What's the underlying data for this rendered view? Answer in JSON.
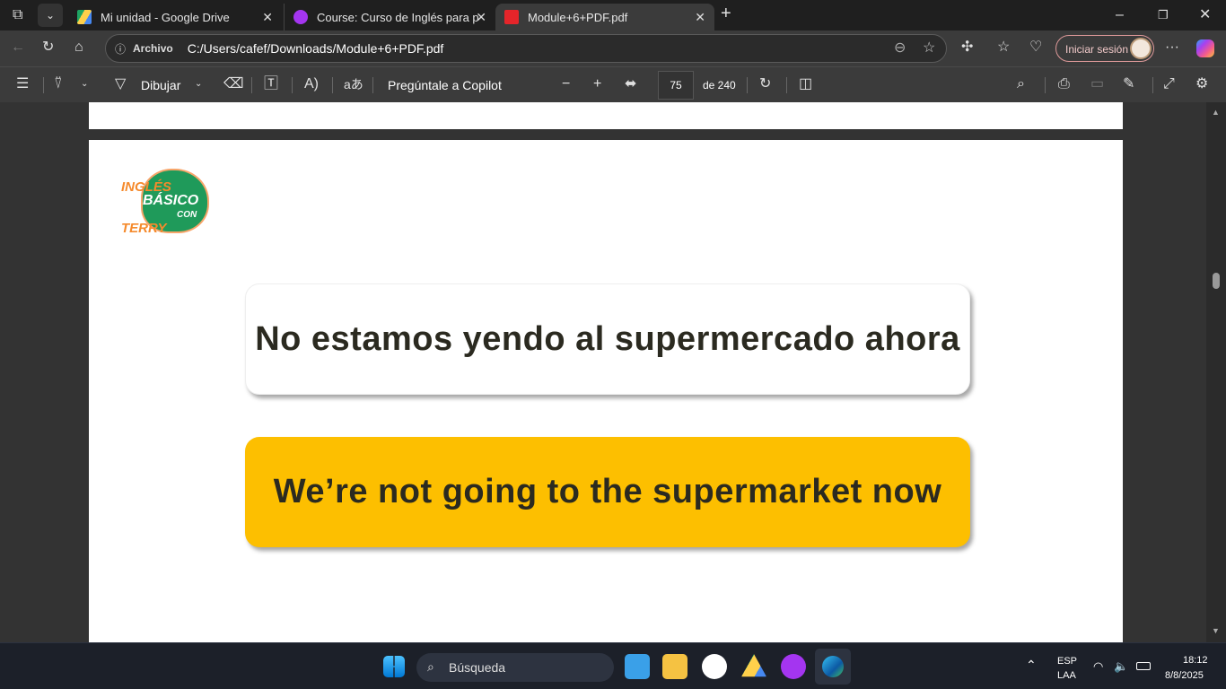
{
  "tabs": [
    {
      "title": "Mi unidad - Google Drive",
      "icon": "google-drive-icon"
    },
    {
      "title": "Course: Curso de Inglés para princ",
      "icon": "udemy-icon"
    },
    {
      "title": "Module+6+PDF.pdf",
      "icon": "pdf-icon",
      "active": true
    }
  ],
  "address": {
    "label": "Archivo",
    "url": "C:/Users/cafef/Downloads/Module+6+PDF.pdf",
    "signin": "Iniciar sesión"
  },
  "pdf_toolbar": {
    "draw": "Dibujar",
    "copilot": "Pregúntale a Copilot",
    "page": "75",
    "of": "de 240"
  },
  "document": {
    "logo": {
      "line1": "INGLÉS",
      "line2": "BÁSICO",
      "line3": "CON",
      "line4": "TERRY"
    },
    "spanish": "No estamos yendo al supermercado ahora",
    "english": "We’re not going to the supermarket now",
    "accent": "#fdbf00"
  },
  "taskbar": {
    "search": "Búsqueda",
    "lang1": "ESP",
    "lang2": "LAA",
    "time": "18:12",
    "date": "8/8/2025"
  }
}
